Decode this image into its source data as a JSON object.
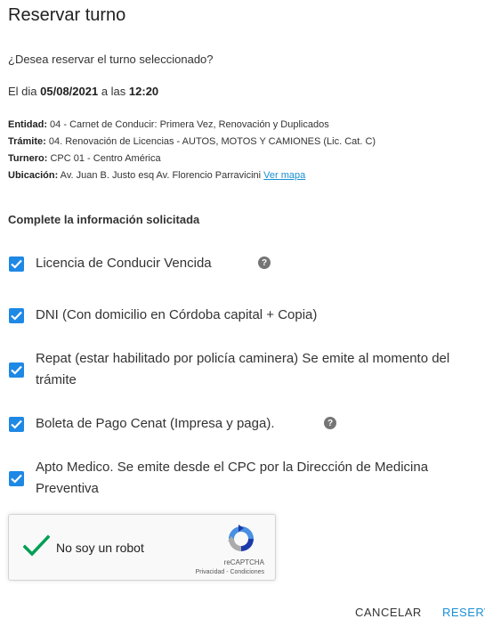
{
  "dialog": {
    "title": "Reservar turno",
    "question": "¿Desea reservar el turno seleccionado?",
    "date_prefix": "El dia ",
    "date": "05/08/2021",
    "time_prefix": " a las ",
    "time": "12:20"
  },
  "details": {
    "entidad_label": "Entidad:",
    "entidad": " 04 - Carnet de Conducir: Primera Vez, Renovación y Duplicados",
    "tramite_label": "Trámite:",
    "tramite": " 04. Renovación de Licencias - AUTOS, MOTOS Y CAMIONES (Lic. Cat. C)",
    "turnero_label": "Turnero:",
    "turnero": " CPC 01 - Centro América",
    "ubicacion_label": "Ubicación:",
    "ubicacion": " Av. Juan B. Justo esq Av. Florencio Parravicini ",
    "map_link": "Ver mapa"
  },
  "requirements": {
    "title": "Complete la información solicitada",
    "items": [
      {
        "label": "Licencia de Conducir Vencida",
        "checked": true,
        "help": true
      },
      {
        "label": "DNI (Con domicilio en Córdoba capital + Copia)",
        "checked": true,
        "help": false
      },
      {
        "label": "Repat (estar habilitado por policía caminera) Se emite al momento del trámite",
        "checked": true,
        "help": false
      },
      {
        "label": "Boleta de Pago Cenat (Impresa y paga).",
        "checked": true,
        "help": true
      },
      {
        "label": "Apto Medico. Se emite desde el CPC por la Dirección de Medicina Preventiva",
        "checked": true,
        "help": false
      }
    ],
    "help_icon": "question-circle-icon"
  },
  "captcha": {
    "label": "No soy un robot",
    "brand": "reCAPTCHA",
    "links": "Privacidad - Condiciones",
    "checked": true,
    "check_color": "#009e55"
  },
  "actions": {
    "cancel": "CANCELAR",
    "reserve": "RESERVAR"
  },
  "colors": {
    "accent": "#1e88e5",
    "link": "#1a8fd6"
  }
}
